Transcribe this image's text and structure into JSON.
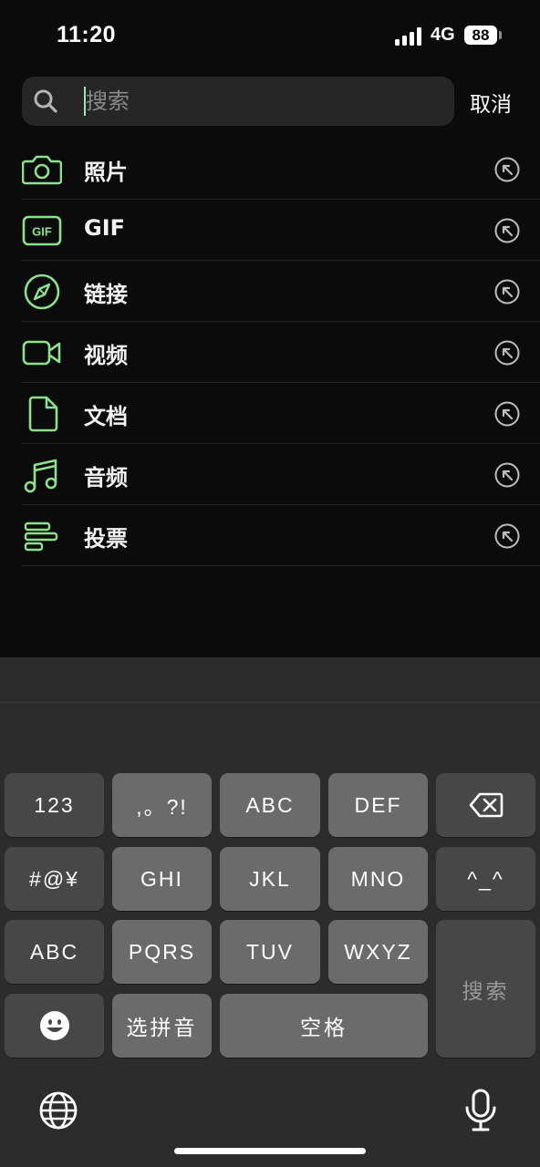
{
  "status": {
    "time": "11:20",
    "network": "4G",
    "battery": "88"
  },
  "search": {
    "placeholder": "搜索",
    "value": "",
    "cancel_label": "取消"
  },
  "categories": [
    {
      "label": "照片",
      "icon": "camera-icon"
    },
    {
      "label": "GIF",
      "icon": "gif-icon",
      "icon_text": "GIF"
    },
    {
      "label": "链接",
      "icon": "compass-icon"
    },
    {
      "label": "视频",
      "icon": "video-icon"
    },
    {
      "label": "文档",
      "icon": "document-icon"
    },
    {
      "label": "音频",
      "icon": "music-icon"
    },
    {
      "label": "投票",
      "icon": "poll-icon"
    }
  ],
  "keyboard": {
    "row1": [
      "123",
      ",。?!",
      "ABC",
      "DEF"
    ],
    "row2": [
      "#@¥",
      "GHI",
      "JKL",
      "MNO",
      "^_^"
    ],
    "row3": [
      "ABC",
      "PQRS",
      "TUV",
      "WXYZ"
    ],
    "row4": [
      "选拼音",
      "空格"
    ],
    "search_label": "搜索"
  },
  "colors": {
    "accent": "#8de08d",
    "background": "#0b0b0b",
    "keyboard_bg": "#2c2c2c"
  }
}
